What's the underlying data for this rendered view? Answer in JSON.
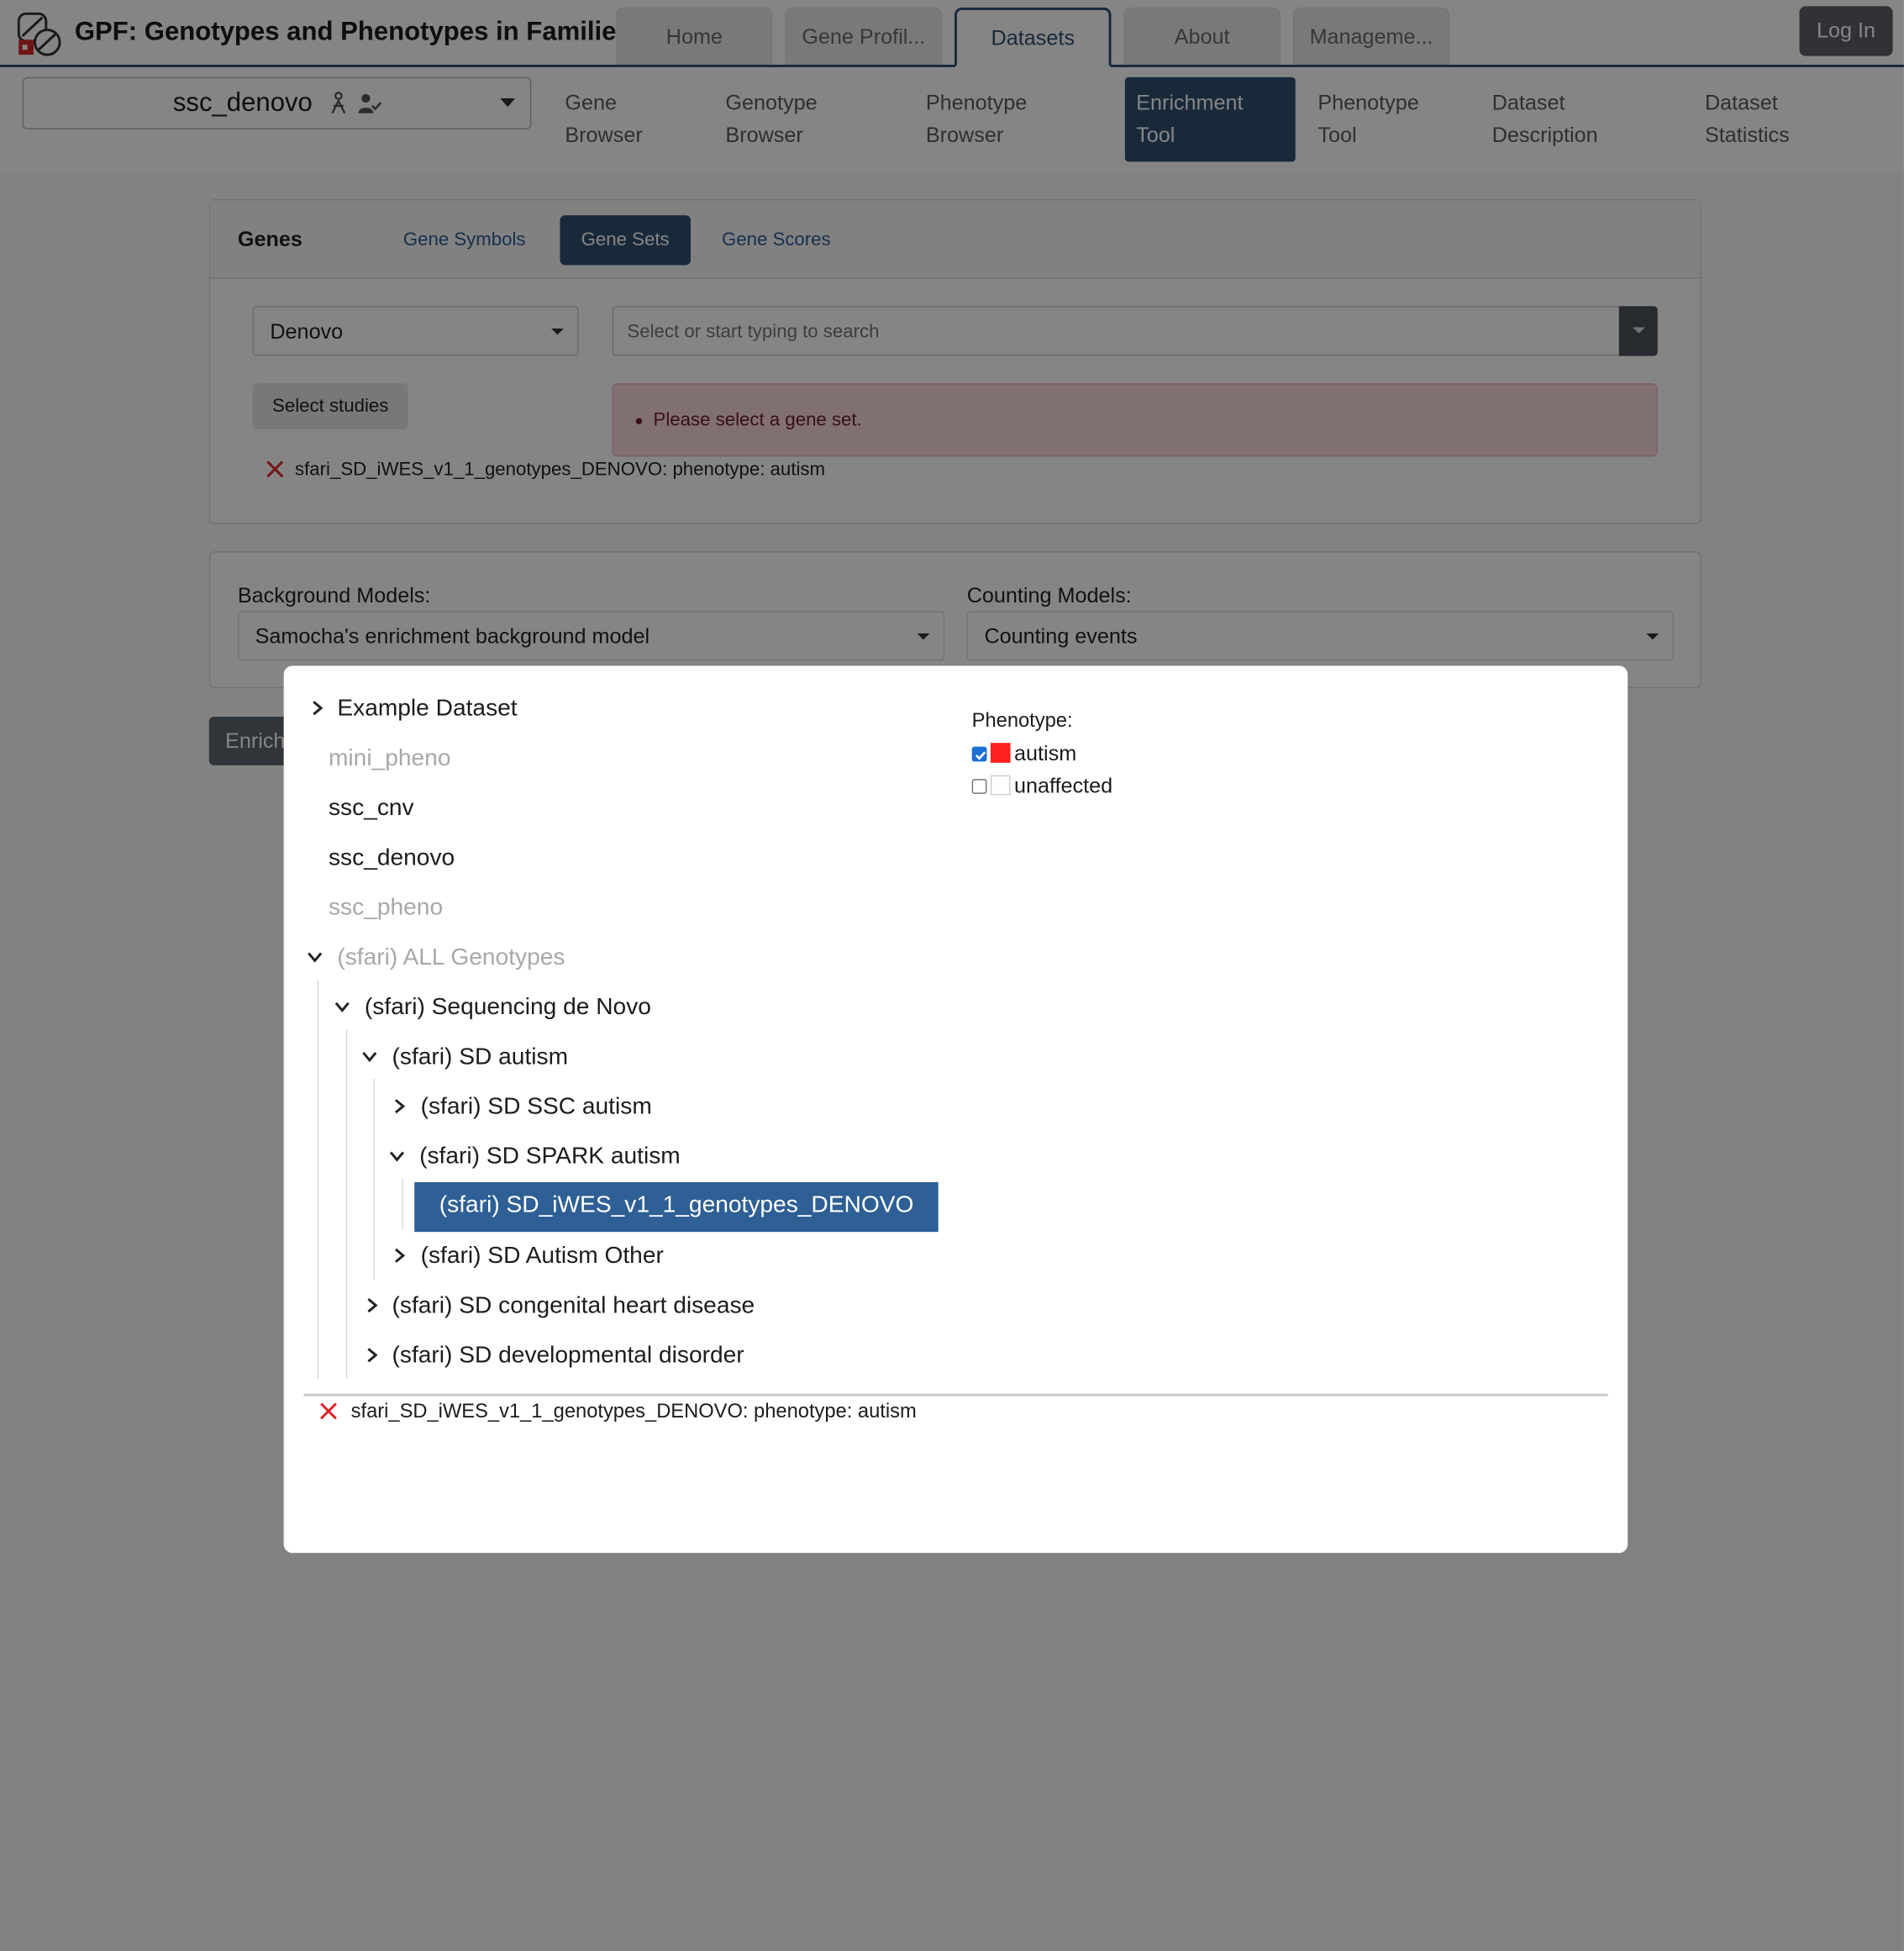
{
  "app": {
    "title": "GPF: Genotypes and Phenotypes in Families"
  },
  "top_tabs": [
    {
      "label": "Home"
    },
    {
      "label": "Gene Profil..."
    },
    {
      "label": "Datasets"
    },
    {
      "label": "About"
    },
    {
      "label": "Manageme..."
    }
  ],
  "login": {
    "label": "Log In"
  },
  "dataset_selector": {
    "value": "ssc_denovo"
  },
  "sub_nav": [
    {
      "line1": "Gene",
      "line2": "Browser"
    },
    {
      "line1": "Genotype",
      "line2": "Browser"
    },
    {
      "line1": "Phenotype",
      "line2": "Browser"
    },
    {
      "line1": "Enrichment",
      "line2": "Tool"
    },
    {
      "line1": "Phenotype",
      "line2": "Tool"
    },
    {
      "line1": "Dataset",
      "line2": "Description"
    },
    {
      "line1": "Dataset",
      "line2": "Statistics"
    }
  ],
  "genes": {
    "title": "Genes",
    "tabs": [
      "Gene Symbols",
      "Gene Sets",
      "Gene Scores"
    ],
    "collection_value": "Denovo",
    "search_placeholder": "Select or start typing to search",
    "select_studies_label": "Select studies",
    "warning": "Please select a gene set.",
    "filter_text": "sfari_SD_iWES_v1_1_genotypes_DENOVO: phenotype: autism"
  },
  "models": {
    "background_label": "Background Models:",
    "background_value": "Samocha's enrichment background model",
    "counting_label": "Counting Models:",
    "counting_value": "Counting events"
  },
  "enrich_button": {
    "label": "Enrich"
  },
  "modal": {
    "tree": [
      {
        "label": "Example Dataset"
      },
      {
        "label": "mini_pheno"
      },
      {
        "label": "ssc_cnv"
      },
      {
        "label": "ssc_denovo"
      },
      {
        "label": "ssc_pheno"
      },
      {
        "label": "(sfari) ALL Genotypes"
      },
      {
        "label": "(sfari) Sequencing de Novo"
      },
      {
        "label": "(sfari) SD autism"
      },
      {
        "label": "(sfari) SD SSC autism"
      },
      {
        "label": "(sfari) SD SPARK autism"
      },
      {
        "label": "(sfari) SD_iWES_v1_1_genotypes_DENOVO"
      },
      {
        "label": "(sfari) SD Autism Other"
      },
      {
        "label": "(sfari) SD congenital heart disease"
      },
      {
        "label": "(sfari) SD developmental disorder"
      }
    ],
    "phenotype_label": "Phenotype:",
    "phenotypes": [
      {
        "label": "autism",
        "checked": true,
        "color": "#ff2020"
      },
      {
        "label": "unaffected",
        "checked": false,
        "color": "#ffffff"
      }
    ],
    "filter_text": "sfari_SD_iWES_v1_1_genotypes_DENOVO: phenotype: autism"
  },
  "colors": {
    "primary": "#2e4f70",
    "selected": "#2e5f95",
    "remove": "#e0242a"
  }
}
